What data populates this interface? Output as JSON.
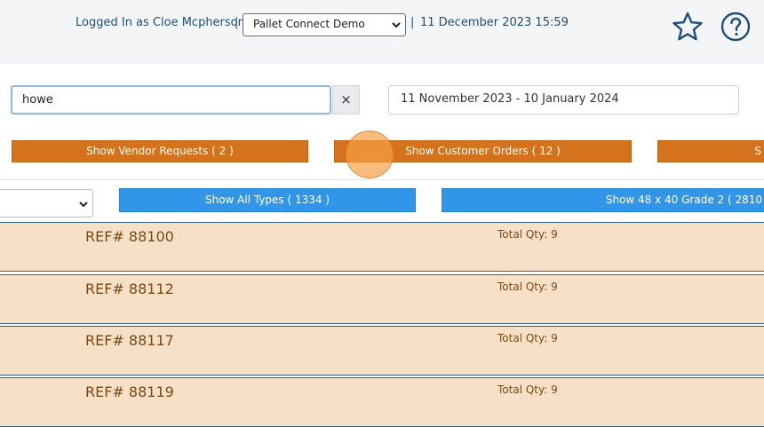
{
  "header": {
    "login_text": "Logged In as Cloe Mcpherson",
    "separator": "|",
    "company_selected": "Pallet Connect Demo",
    "datetime": "11 December 2023 15:59",
    "favorite_icon": "star-outline-icon",
    "help_icon": "question-circle-icon"
  },
  "filters": {
    "search_value": "howe",
    "clear_label": "×",
    "date_range": "11 November 2023 - 10 January 2024"
  },
  "request_buttons": {
    "vendor_requests": "Show Vendor Requests ( 2 )",
    "customer_orders": "Show Customer Orders ( 12 )",
    "third": "S"
  },
  "type_buttons": {
    "all_types": "Show All Types ( 1334 )",
    "grade2": "Show 48 x 40 Grade 2 ( 2810"
  },
  "orders": [
    {
      "ref": "REF# 88100",
      "qty": "Total Qty: 9"
    },
    {
      "ref": "REF# 88112",
      "qty": "Total Qty: 9"
    },
    {
      "ref": "REF# 88117",
      "qty": "Total Qty: 9"
    },
    {
      "ref": "REF# 88119",
      "qty": "Total Qty: 9"
    }
  ],
  "colors": {
    "orange_button": "#d4731b",
    "blue_button": "#3196e8",
    "order_row_bg": "#f6e1c8",
    "header_text": "#1f4e79"
  }
}
